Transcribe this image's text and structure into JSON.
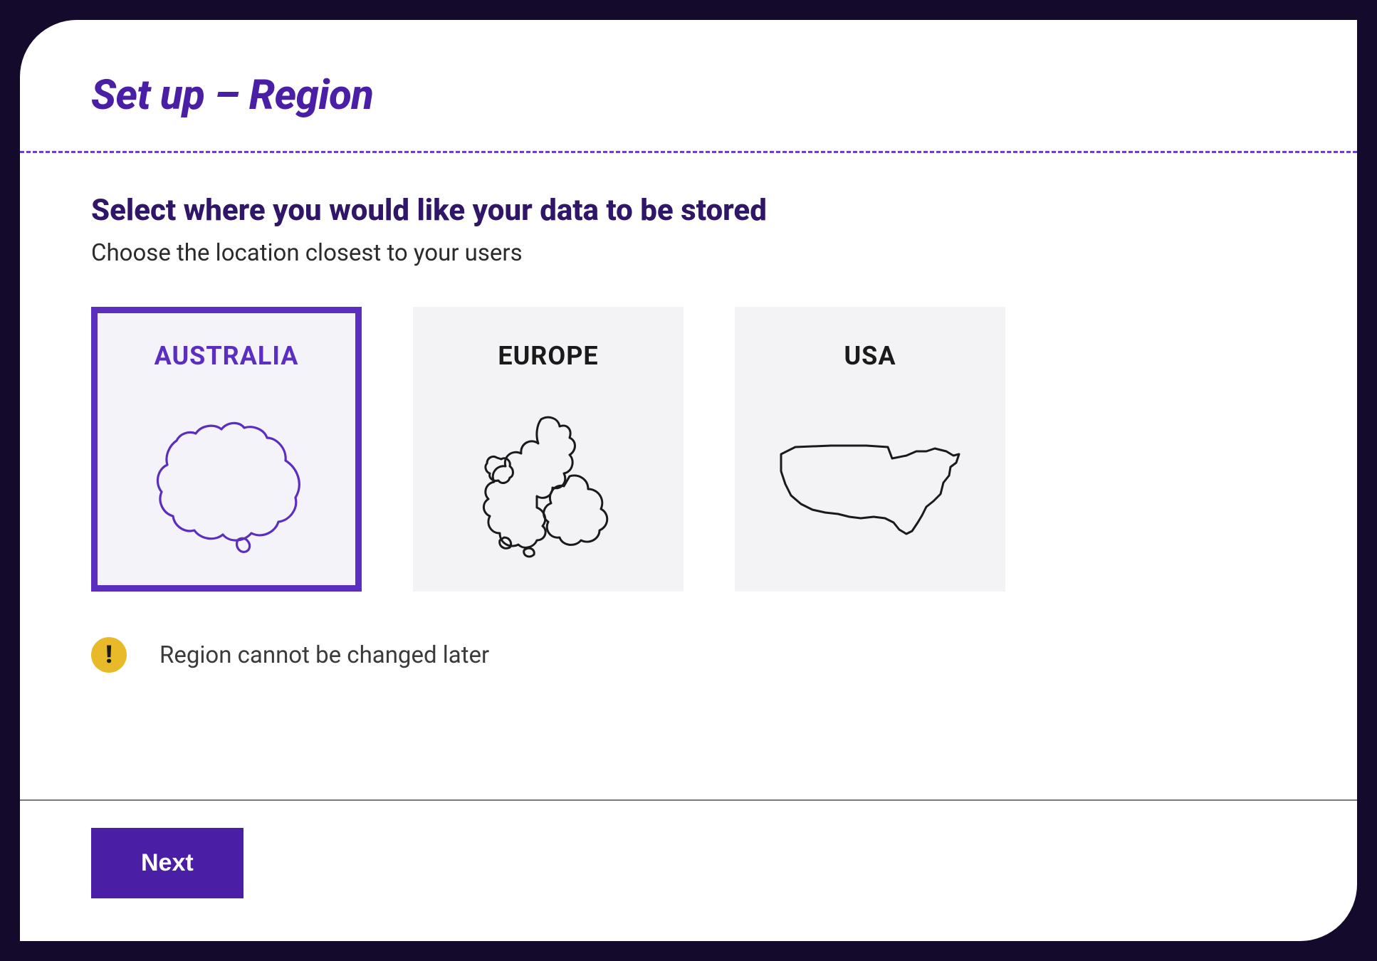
{
  "header": {
    "title": "Set up – Region"
  },
  "content": {
    "subtitle": "Select where you would like your data to be stored",
    "description": "Choose the location closest to your users"
  },
  "regions": [
    {
      "label": "AUSTRALIA",
      "selected": true
    },
    {
      "label": "EUROPE",
      "selected": false
    },
    {
      "label": "USA",
      "selected": false
    }
  ],
  "warning": {
    "text": "Region cannot be changed later"
  },
  "footer": {
    "next_label": "Next"
  },
  "colors": {
    "accent": "#5b2ebf",
    "warning": "#e8b928",
    "button": "#4a1fa6"
  }
}
